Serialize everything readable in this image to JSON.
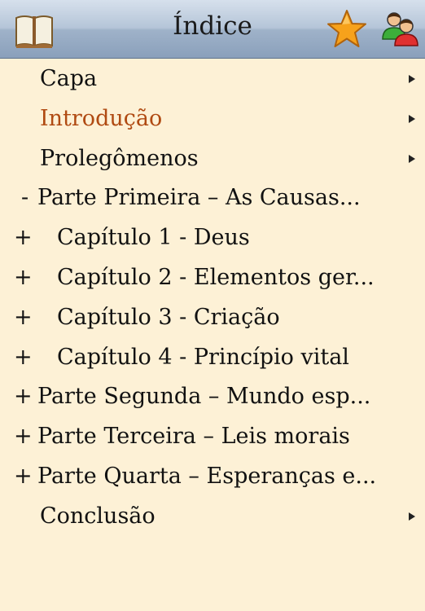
{
  "header": {
    "title": "Índice",
    "icons": [
      "book-icon",
      "star-icon",
      "users-icon"
    ],
    "colors": {
      "bar_top": "#d6e0ec",
      "bar_bottom": "#8aa0bb",
      "star": "#f7a21b"
    }
  },
  "list": {
    "active_color": "#b04a12",
    "background": "#fdf1d6",
    "items": [
      {
        "marker": "",
        "label": "Capa"
      },
      {
        "marker": "",
        "label": "Introdução"
      },
      {
        "marker": "",
        "label": "Prolegômenos"
      },
      {
        "marker": "-",
        "label": "Parte Primeira – As Causas..."
      },
      {
        "marker": "+",
        "label": "Capítulo 1 - Deus"
      },
      {
        "marker": "+",
        "label": "Capítulo 2 - Elementos ger..."
      },
      {
        "marker": "+",
        "label": "Capítulo 3 - Criação"
      },
      {
        "marker": "+",
        "label": "Capítulo 4 - Princípio vital"
      },
      {
        "marker": "+",
        "label": "Parte Segunda – Mundo esp..."
      },
      {
        "marker": "+",
        "label": "Parte Terceira – Leis morais"
      },
      {
        "marker": "+",
        "label": "Parte Quarta – Esperanças e..."
      },
      {
        "marker": "",
        "label": "Conclusão"
      }
    ]
  }
}
